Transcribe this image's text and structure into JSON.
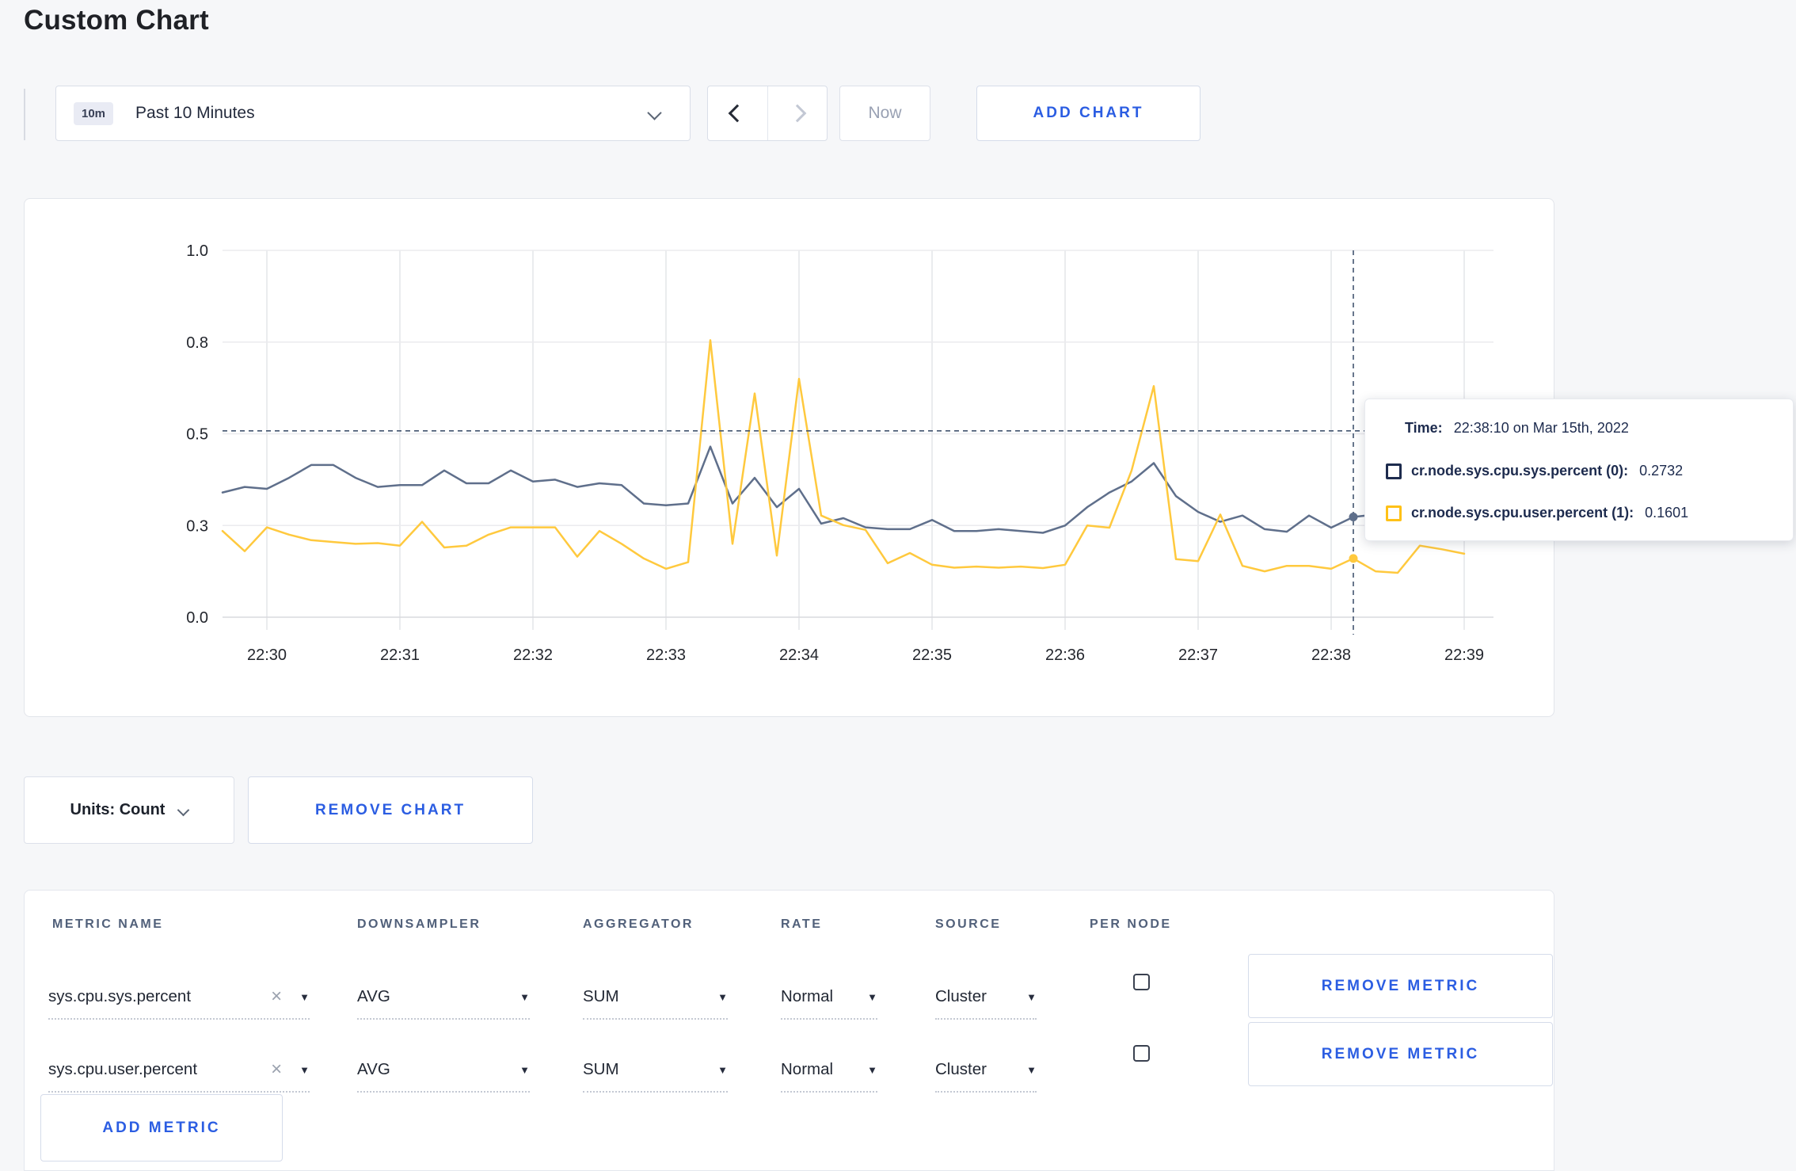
{
  "page": {
    "title": "Custom Chart"
  },
  "toolbar": {
    "time_range": {
      "badge": "10m",
      "label": "Past 10 Minutes"
    },
    "now_label": "Now",
    "add_chart_label": "ADD CHART"
  },
  "chart_controls": {
    "units_label": "Units: Count",
    "remove_chart_label": "REMOVE CHART"
  },
  "icons": {
    "caret_down": "▼",
    "close": "×"
  },
  "chart_data": {
    "type": "line",
    "title": "",
    "xlabel": "",
    "ylabel": "",
    "x_start": "22:29:40",
    "x_end": "22:39:00",
    "sample_interval_seconds": 10,
    "x_tick_labels": [
      "22:30",
      "22:31",
      "22:32",
      "22:33",
      "22:34",
      "22:35",
      "22:36",
      "22:37",
      "22:38",
      "22:39"
    ],
    "first_tick_sample_offset": 2,
    "samples_per_tick": 6,
    "ylim": [
      0,
      1
    ],
    "grid": true,
    "y_ticks": [
      {
        "value": 0.0,
        "label": "0.0"
      },
      {
        "value": 0.25,
        "label": "0.3"
      },
      {
        "value": 0.5,
        "label": "0.5"
      },
      {
        "value": 0.75,
        "label": "0.8"
      },
      {
        "value": 1.0,
        "label": "1.0"
      }
    ],
    "series": [
      {
        "name": "cr.node.sys.cpu.sys.percent (0)",
        "color": "#5f6f8b",
        "values": [
          0.34,
          0.355,
          0.35,
          0.38,
          0.415,
          0.415,
          0.38,
          0.355,
          0.36,
          0.36,
          0.4,
          0.365,
          0.365,
          0.4,
          0.37,
          0.375,
          0.355,
          0.365,
          0.36,
          0.31,
          0.305,
          0.31,
          0.465,
          0.31,
          0.38,
          0.3,
          0.35,
          0.255,
          0.27,
          0.245,
          0.24,
          0.24,
          0.265,
          0.235,
          0.235,
          0.24,
          0.235,
          0.23,
          0.25,
          0.3,
          0.34,
          0.37,
          0.42,
          0.33,
          0.287,
          0.26,
          0.277,
          0.24,
          0.233,
          0.277,
          0.244,
          0.2732,
          0.28,
          0.29,
          0.3,
          0.295,
          0.29
        ]
      },
      {
        "name": "cr.node.sys.cpu.user.percent (1)",
        "color": "#ffc93e",
        "values": [
          0.235,
          0.18,
          0.245,
          0.225,
          0.21,
          0.205,
          0.2,
          0.202,
          0.195,
          0.26,
          0.19,
          0.195,
          0.225,
          0.245,
          0.245,
          0.245,
          0.165,
          0.235,
          0.2,
          0.16,
          0.132,
          0.15,
          0.755,
          0.2,
          0.61,
          0.168,
          0.65,
          0.277,
          0.251,
          0.238,
          0.147,
          0.175,
          0.143,
          0.135,
          0.138,
          0.135,
          0.138,
          0.134,
          0.143,
          0.25,
          0.244,
          0.4,
          0.63,
          0.158,
          0.153,
          0.28,
          0.14,
          0.125,
          0.14,
          0.14,
          0.132,
          0.1601,
          0.125,
          0.121,
          0.195,
          0.185,
          0.173
        ]
      }
    ],
    "crosshair": {
      "sample_index": 51,
      "time": "22:38:10",
      "y_value": 0.508
    },
    "tooltip": {
      "time_label": "Time:",
      "time_value": "22:38:10 on Mar 15th, 2022",
      "rows": [
        {
          "label": "cr.node.sys.cpu.sys.percent (0):",
          "value": "0.2732",
          "swatch_color": "#1e2c4e"
        },
        {
          "label": "cr.node.sys.cpu.user.percent (1):",
          "value": "0.1601",
          "swatch_color": "#ffc117"
        }
      ]
    }
  },
  "metrics_table": {
    "headers": [
      "METRIC NAME",
      "DOWNSAMPLER",
      "AGGREGATOR",
      "RATE",
      "SOURCE",
      "PER NODE"
    ],
    "rows": [
      {
        "metric": "sys.cpu.sys.percent",
        "downsampler": "AVG",
        "aggregator": "SUM",
        "rate": "Normal",
        "source": "Cluster",
        "per_node": false,
        "remove_label": "REMOVE METRIC"
      },
      {
        "metric": "sys.cpu.user.percent",
        "downsampler": "AVG",
        "aggregator": "SUM",
        "rate": "Normal",
        "source": "Cluster",
        "per_node": false,
        "remove_label": "REMOVE METRIC"
      }
    ],
    "add_metric_label": "ADD METRIC"
  }
}
